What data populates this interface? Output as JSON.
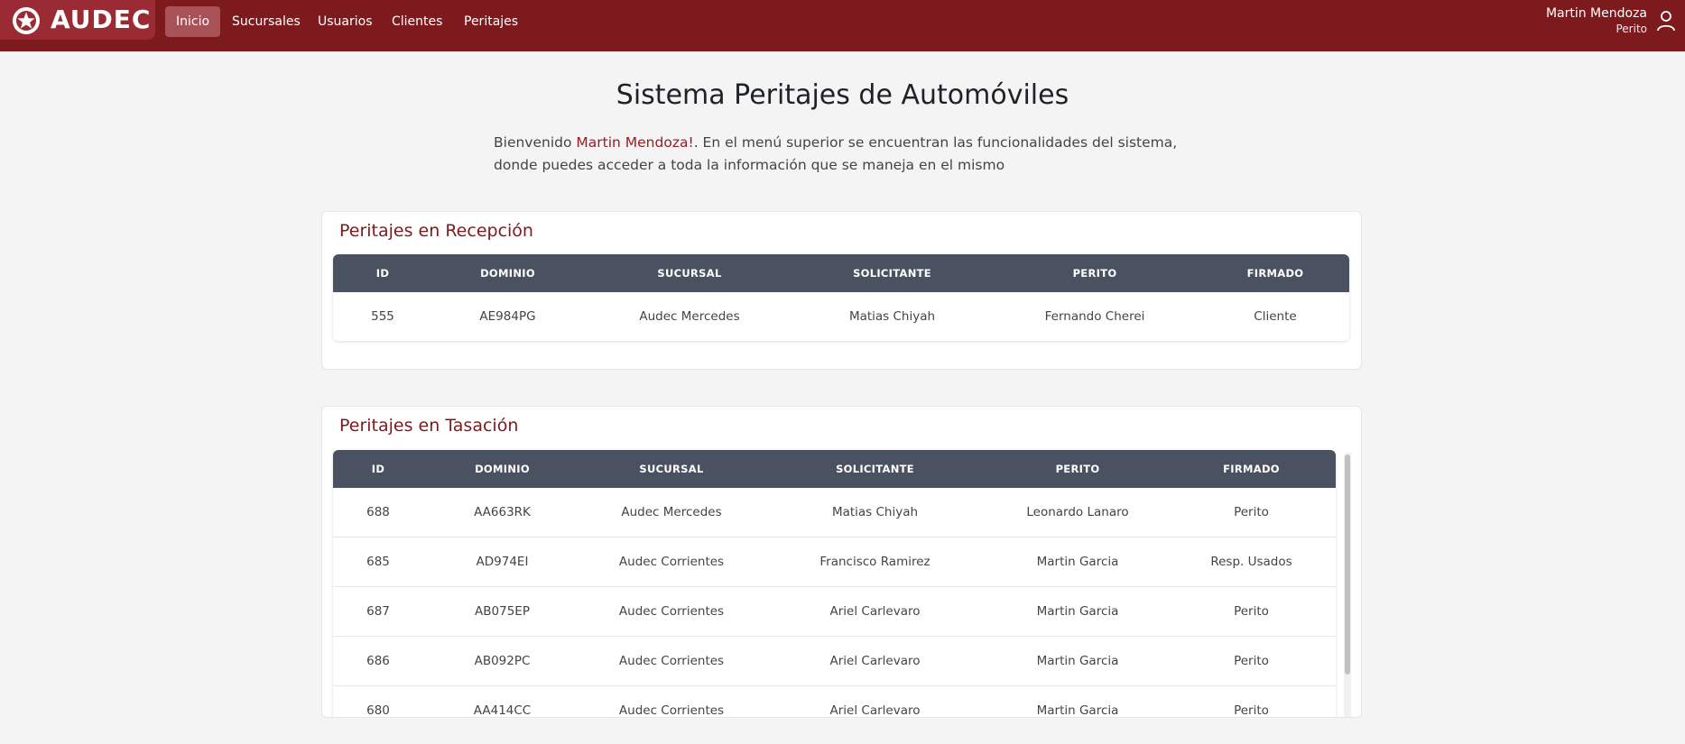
{
  "brand": {
    "name": "AUDEC"
  },
  "nav": {
    "items": [
      {
        "label": "Inicio",
        "active": true
      },
      {
        "label": "Sucursales",
        "active": false
      },
      {
        "label": "Usuarios",
        "active": false
      },
      {
        "label": "Clientes",
        "active": false
      },
      {
        "label": "Peritajes",
        "active": false
      }
    ]
  },
  "user": {
    "name": "Martin Mendoza",
    "role": "Perito"
  },
  "header": {
    "title": "Sistema Peritajes de Automóviles",
    "intro_prefix": "Bienvenido ",
    "intro_name": "Martin Mendoza!",
    "intro_suffix": ". En el menú superior se encuentran las funcionalidades del sistema, donde puedes acceder a toda la información que se maneja en el mismo"
  },
  "reception": {
    "title": "Peritajes en Recepción",
    "columns": [
      "ID",
      "DOMINIO",
      "SUCURSAL",
      "SOLICITANTE",
      "PERITO",
      "FIRMADO"
    ],
    "rows": [
      [
        "555",
        "AE984PG",
        "Audec Mercedes",
        "Matias Chiyah",
        "Fernando Cherei",
        "Cliente"
      ]
    ]
  },
  "appraisal": {
    "title": "Peritajes en Tasación",
    "columns": [
      "ID",
      "DOMINIO",
      "SUCURSAL",
      "SOLICITANTE",
      "PERITO",
      "FIRMADO"
    ],
    "rows": [
      [
        "688",
        "AA663RK",
        "Audec Mercedes",
        "Matias Chiyah",
        "Leonardo Lanaro",
        "Perito"
      ],
      [
        "685",
        "AD974EI",
        "Audec Corrientes",
        "Francisco Ramirez",
        "Martin Garcia",
        "Resp. Usados"
      ],
      [
        "687",
        "AB075EP",
        "Audec Corrientes",
        "Ariel Carlevaro",
        "Martin Garcia",
        "Perito"
      ],
      [
        "686",
        "AB092PC",
        "Audec Corrientes",
        "Ariel Carlevaro",
        "Martin Garcia",
        "Perito"
      ],
      [
        "680",
        "AA414CC",
        "Audec Corrientes",
        "Ariel Carlevaro",
        "Martin Garcia",
        "Perito"
      ]
    ]
  },
  "colors": {
    "navbar": "#7d1a1e",
    "accent": "#9b1c22",
    "table_header": "#4a5262",
    "background": "#f4f4f4"
  },
  "icons": {
    "brand": "star-wheel-icon",
    "user": "user-icon"
  }
}
